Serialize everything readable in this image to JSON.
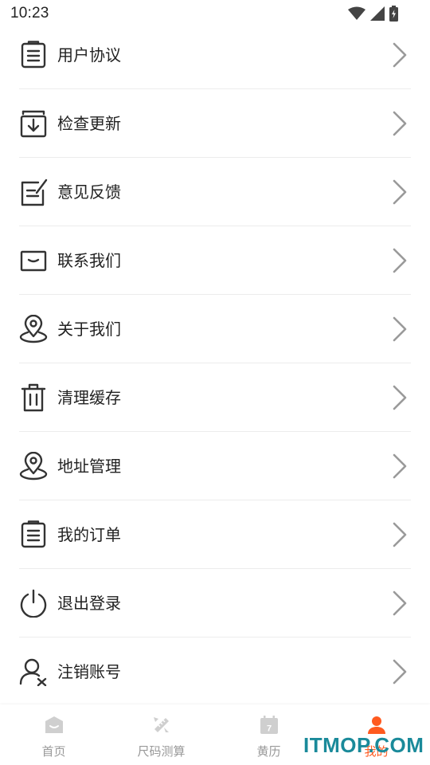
{
  "status_bar": {
    "time": "10:23"
  },
  "menu": [
    {
      "label": "用户协议",
      "icon": "document-list-icon"
    },
    {
      "label": "检查更新",
      "icon": "download-box-icon"
    },
    {
      "label": "意见反馈",
      "icon": "edit-note-icon"
    },
    {
      "label": "联系我们",
      "icon": "mail-icon"
    },
    {
      "label": "关于我们",
      "icon": "location-pin-icon"
    },
    {
      "label": "清理缓存",
      "icon": "trash-icon"
    },
    {
      "label": "地址管理",
      "icon": "location-pin-icon"
    },
    {
      "label": "我的订单",
      "icon": "document-list-icon"
    },
    {
      "label": "退出登录",
      "icon": "power-icon"
    },
    {
      "label": "注销账号",
      "icon": "user-remove-icon"
    }
  ],
  "tabs": [
    {
      "label": "首页",
      "icon": "home-icon",
      "active": false
    },
    {
      "label": "尺码测算",
      "icon": "ruler-pencil-icon",
      "active": false
    },
    {
      "label": "黄历",
      "icon": "calendar-icon",
      "active": false
    },
    {
      "label": "我的",
      "icon": "user-icon",
      "active": true
    }
  ],
  "calendar_day": "7",
  "colors": {
    "accent": "#ff5a1f",
    "inactive": "#999999",
    "divider": "#ececec"
  },
  "watermark": "ITMOP.COM"
}
